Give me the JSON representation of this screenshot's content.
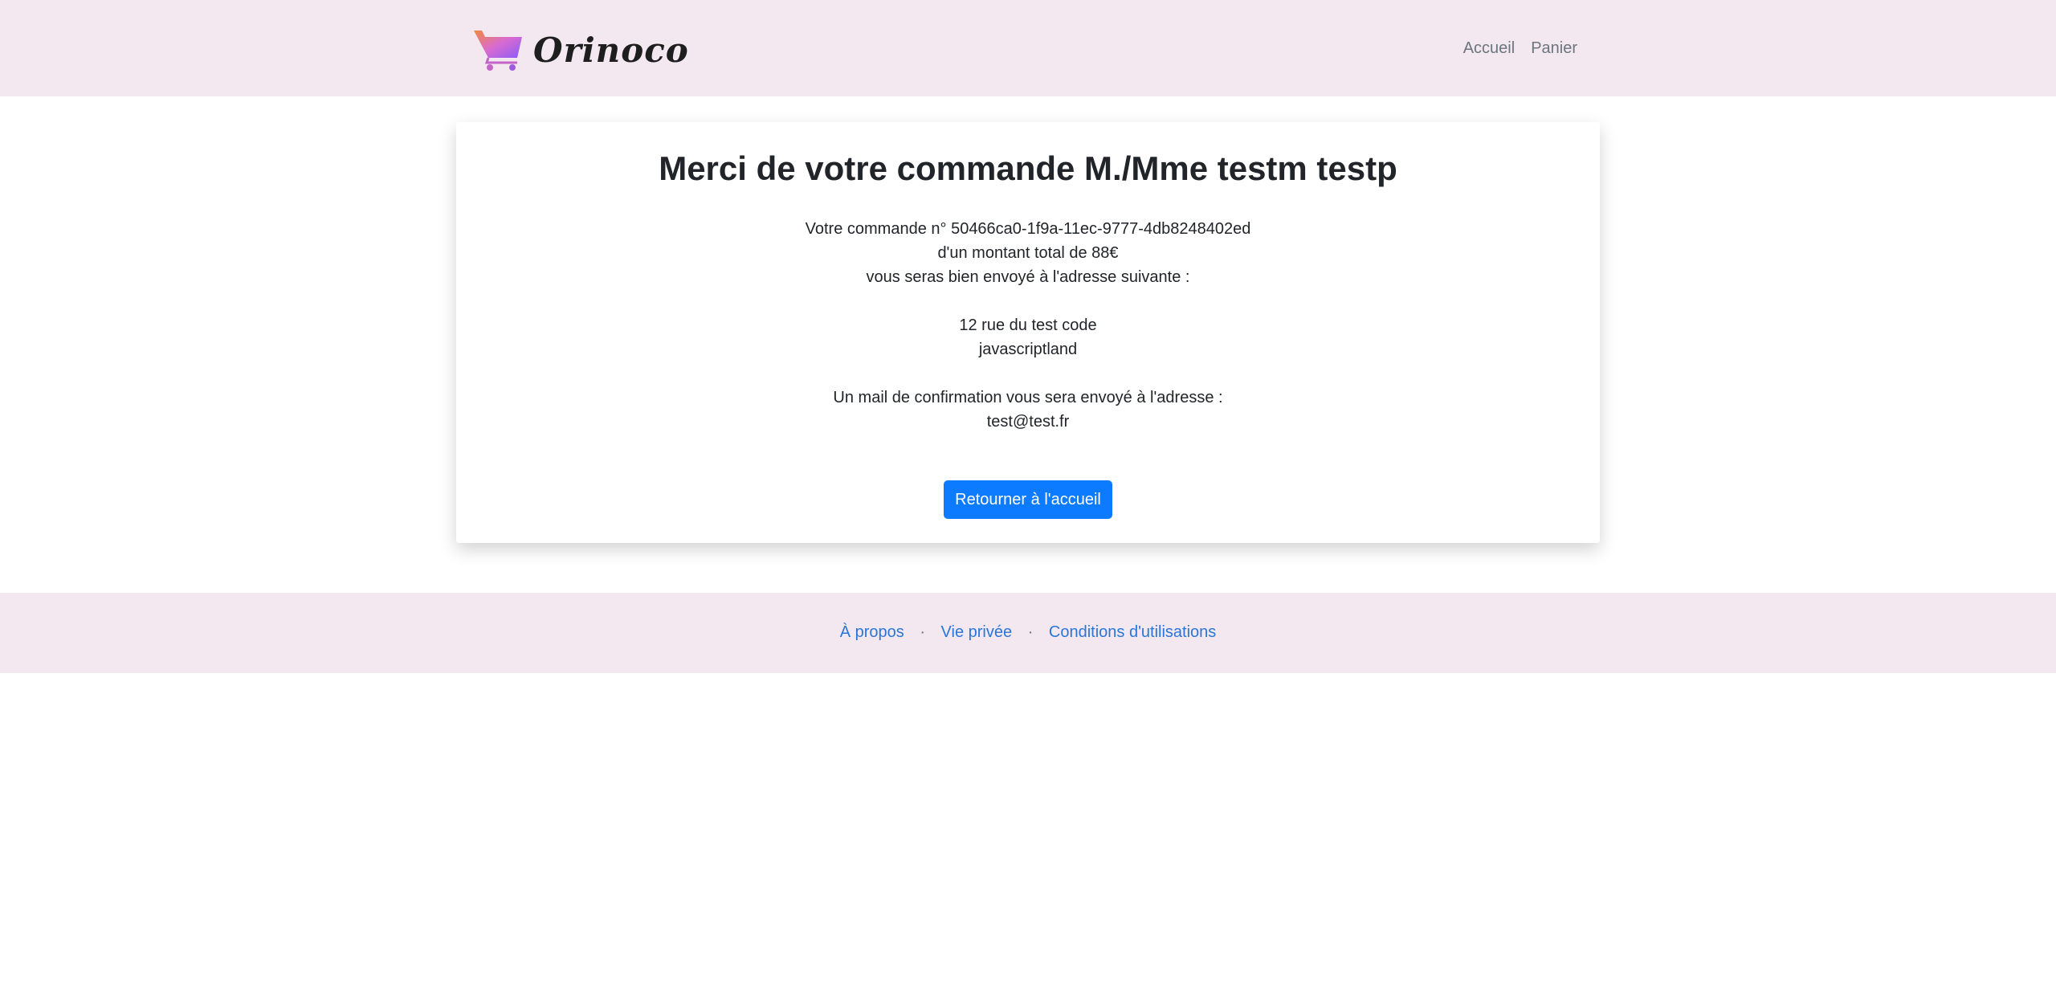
{
  "navbar": {
    "brand_name": "Orinoco",
    "links": [
      "Accueil",
      "Panier"
    ]
  },
  "confirmation": {
    "title": "Merci de votre commande M./Mme testm testp",
    "order_line": "Votre commande n° 50466ca0-1f9a-11ec-9777-4db8248402ed",
    "amount_line": "d'un montant total de 88€",
    "address_intro": "vous seras bien envoyé à l'adresse suivante :",
    "address_street": "12 rue du test code",
    "address_city": "javascriptland",
    "mail_intro": "Un mail de confirmation vous sera envoyé à l'adresse :",
    "email": "test@test.fr",
    "button_label": "Retourner à l'accueil"
  },
  "footer": {
    "links": [
      "À propos",
      "Vie privée",
      "Conditions d'utilisations"
    ],
    "separator": "·"
  },
  "colors": {
    "bar_background": "#f3e8f0",
    "button": "#0d7bff",
    "link": "#2a76d8"
  }
}
